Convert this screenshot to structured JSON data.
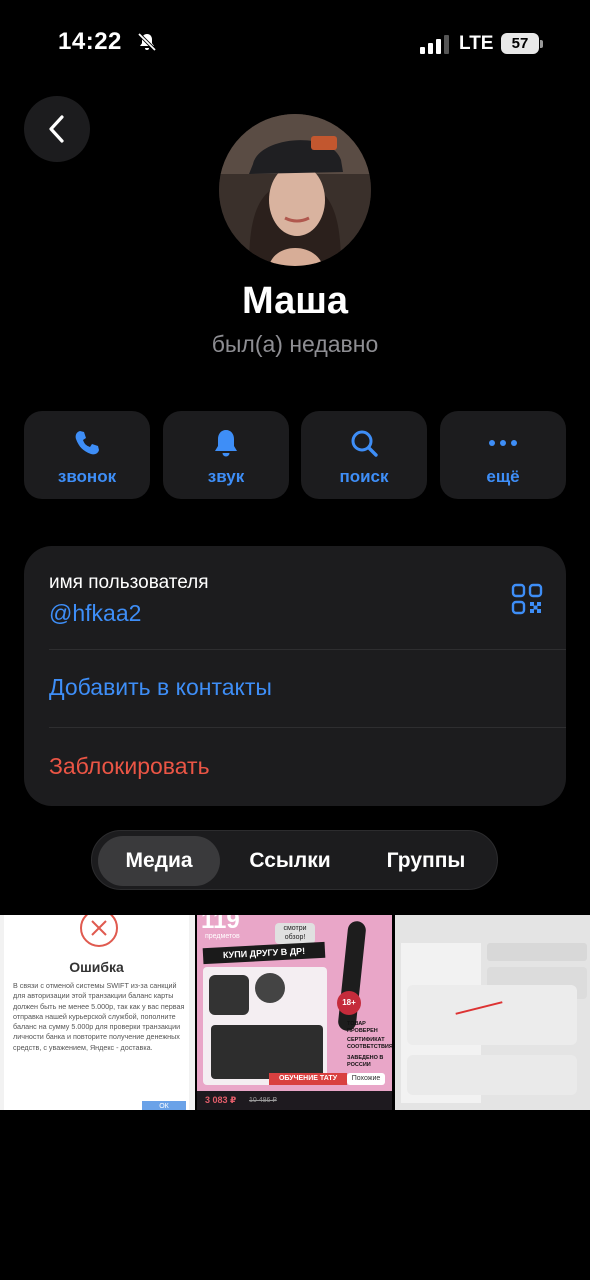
{
  "status_bar": {
    "time": "14:22",
    "network": "LTE",
    "battery": "57"
  },
  "profile": {
    "name": "Маша",
    "status": "был(а) недавно"
  },
  "actions": [
    {
      "label": "звонок",
      "icon": "phone-icon"
    },
    {
      "label": "звук",
      "icon": "bell-icon"
    },
    {
      "label": "поиск",
      "icon": "search-icon"
    },
    {
      "label": "ещё",
      "icon": "more-icon"
    }
  ],
  "info": {
    "username_label": "имя пользователя",
    "username": "@hfkaa2",
    "add_contact": "Добавить в контакты",
    "block": "Заблокировать"
  },
  "tabs": [
    {
      "label": "Медиа",
      "active": true
    },
    {
      "label": "Ссылки",
      "active": false
    },
    {
      "label": "Группы",
      "active": false
    }
  ],
  "media": {
    "thumb1": {
      "title": "Ошибка",
      "text": "В связи с отменой системы SWIFT из-за санкций для авторизации этой транзакции баланс карты должен быть не менее 5.000р, так как у вас первая отправка нашей курьерской службой, пополните баланс на сумму 5.000р для проверки транзакции личности банка и повторите получение денежных средств, с уважением, Яндекс - доставка.",
      "button": "ОК"
    },
    "thumb2": {
      "count": "119",
      "count_caption": "предметов",
      "badge": "смотри обзор!",
      "banner": "КУПИ ДРУГУ В ДР!",
      "age": "18+",
      "features": [
        "ТОВАР ПРОВЕРЕН",
        "СЕРТИФИКАТ СООТВЕТСТВИЯ",
        "ЗАВЕДЕНО В РОССИИ"
      ],
      "course": "ОБУЧЕНИЕ ТАТУ",
      "similar": "Похожие",
      "price": "3 083 ₽",
      "old_price": "10 486 ₽"
    },
    "thumb3": {}
  },
  "colors": {
    "accent": "#3e8ef7",
    "danger": "#eb5545",
    "surface": "#1c1c1e"
  }
}
